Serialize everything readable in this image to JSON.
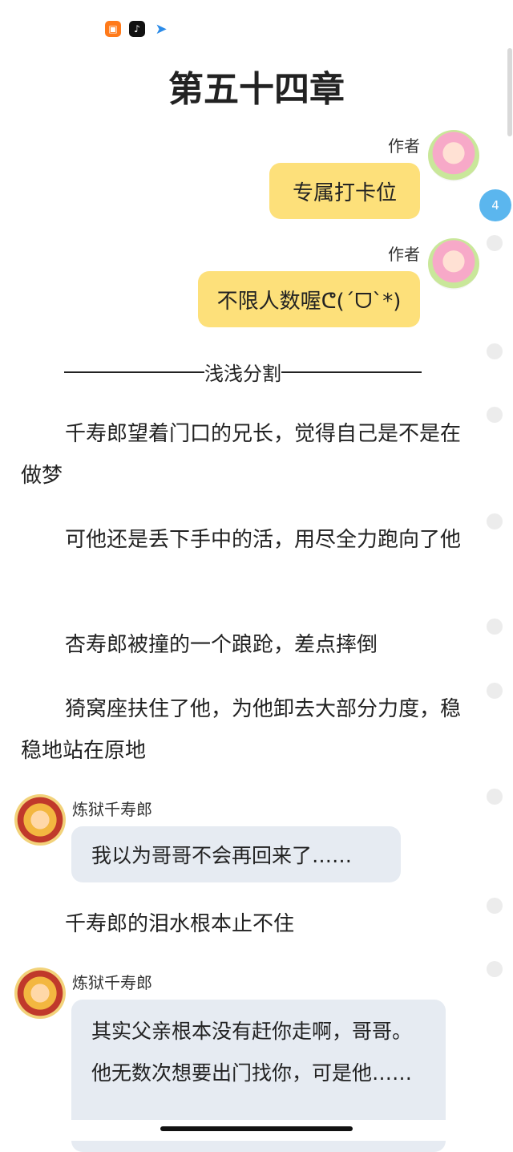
{
  "status_icons": [
    "shopping-bag-icon",
    "tiktok-icon",
    "paper-plane-icon"
  ],
  "chapter_title": "第五十四章",
  "messages_top": [
    {
      "author_label": "作者",
      "text": "专属打卡位"
    },
    {
      "author_label": "作者",
      "text": "不限人数喔ᕦ(ˊᗜˋ*)"
    }
  ],
  "divider_text": "浅浅分割",
  "paragraphs": [
    "千寿郎望着门口的兄长，觉得自己是不是在做梦",
    "可他还是丢下手中的活，用尽全力跑向了他",
    "杏寿郎被撞的一个踉跄，差点摔倒",
    "猗窝座扶住了他，为他卸去大部分力度，稳稳地站在原地"
  ],
  "character_messages": [
    {
      "name": "炼狱千寿郎",
      "text": "我以为哥哥不会再回来了……"
    },
    {
      "name": "炼狱千寿郎",
      "text": "其实父亲根本没有赶你走啊，哥哥。他无数次想要出门找你，可是他……"
    }
  ],
  "paragraph_after": "千寿郎的泪水根本止不住",
  "comment_badge": "4",
  "colors": {
    "author_bubble": "#fde07a",
    "character_bubble": "#e6ebf2",
    "badge": "#5bb6ee"
  }
}
